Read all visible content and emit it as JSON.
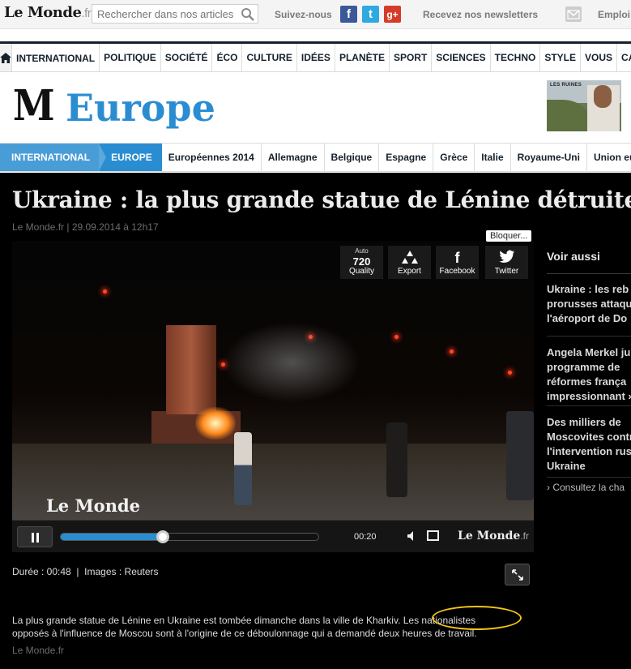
{
  "topbar": {
    "logo": "Le Monde",
    "logo_suffix": ".fr",
    "search_placeholder": "Rechercher dans nos articles",
    "follow_label": "Suivez-nous",
    "social": {
      "facebook": "f",
      "twitter": "t",
      "googleplus": "g+"
    },
    "newsletter_label": "Recevez nos newsletters",
    "emploi_label": "Emploi"
  },
  "main_nav": {
    "items": [
      "INTERNATIONAL",
      "POLITIQUE",
      "SOCIÉTÉ",
      "ÉCO",
      "CULTURE",
      "IDÉES",
      "PLANÈTE",
      "SPORT",
      "SCIENCES",
      "TECHNO",
      "STYLE",
      "VOUS",
      "CAMP"
    ],
    "active": "INTERNATIONAL"
  },
  "section": {
    "masthead_letter": "M",
    "title": "Europe",
    "ad_text": "LES RUINES"
  },
  "sub_nav": {
    "breadcrumb": [
      "INTERNATIONAL",
      "EUROPE"
    ],
    "items": [
      "Européennes 2014",
      "Allemagne",
      "Belgique",
      "Espagne",
      "Grèce",
      "Italie",
      "Royaume-Uni",
      "Union euro"
    ]
  },
  "article": {
    "headline": "Ukraine : la plus grande statue de Lénine détruite",
    "byline": "Le Monde.fr | 29.09.2014 à 12h17",
    "video": {
      "quality_auto": "Auto",
      "quality_value": "720",
      "quality_label": "Quality",
      "export_label": "Export",
      "facebook_label": "Facebook",
      "twitter_label": "Twitter",
      "block_badge": "Bloquer...",
      "watermark": "Le Monde",
      "time": "00:20",
      "progress": 0.4,
      "player_logo": "Le Monde",
      "player_logo_suffix": ".fr"
    },
    "meta": "Durée : 00:48  |  Images : Reuters",
    "caption_line1": "La plus grande statue de Lénine en Ukraine est tombée dimanche dans la ville de Kharkiv. Les nationalistes",
    "caption_line2": "opposés à l'influence de Moscou sont à l'origine de ce déboulonnage qui a demandé deux heures de travail.",
    "caption_source": "Le Monde.fr"
  },
  "sidebar": {
    "title": "Voir aussi",
    "links": [
      [
        "Ukraine : les reb",
        "prorusses attaqu",
        "l'aéroport de Do"
      ],
      [
        "Angela Merkel ju",
        "programme de",
        "réformes frança",
        "impressionnant »"
      ],
      [
        "Des milliers de",
        "Moscovites contr",
        "l'intervention rus",
        "Ukraine"
      ]
    ],
    "consult": "› Consultez la cha"
  },
  "colors": {
    "accent": "#2a8dd1",
    "highlight": "#f0c419"
  }
}
